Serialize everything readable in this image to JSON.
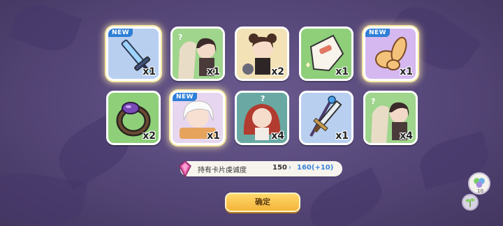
{
  "cards": [
    {
      "id": "sword",
      "bg": "blue",
      "new": true,
      "count": "x1",
      "new_label": "NEW"
    },
    {
      "id": "char-mystery",
      "bg": "green",
      "new": false,
      "count": "x1",
      "qmark": "?"
    },
    {
      "id": "char-bear",
      "bg": "green",
      "new": false,
      "count": "x2"
    },
    {
      "id": "cloth",
      "bg": "green",
      "new": false,
      "count": "x1"
    },
    {
      "id": "rabbit-pouch",
      "bg": "purple",
      "new": true,
      "count": "x1",
      "new_label": "NEW"
    },
    {
      "id": "ring",
      "bg": "green",
      "new": false,
      "count": "x2"
    },
    {
      "id": "char-white",
      "bg": "purple",
      "new": true,
      "count": "x1",
      "new_label": "NEW"
    },
    {
      "id": "char-red",
      "bg": "green",
      "new": false,
      "count": "x4",
      "qmark": "?"
    },
    {
      "id": "staff-sword",
      "bg": "blue",
      "new": false,
      "count": "x1"
    },
    {
      "id": "char-mystery2",
      "bg": "green",
      "new": false,
      "count": "x4",
      "qmark": "?"
    }
  ],
  "info": {
    "label": "持有卡片虔诚度",
    "current": "150",
    "arrow": "›",
    "next": "160(+10)"
  },
  "confirm_label": "确定",
  "side_count": "10"
}
